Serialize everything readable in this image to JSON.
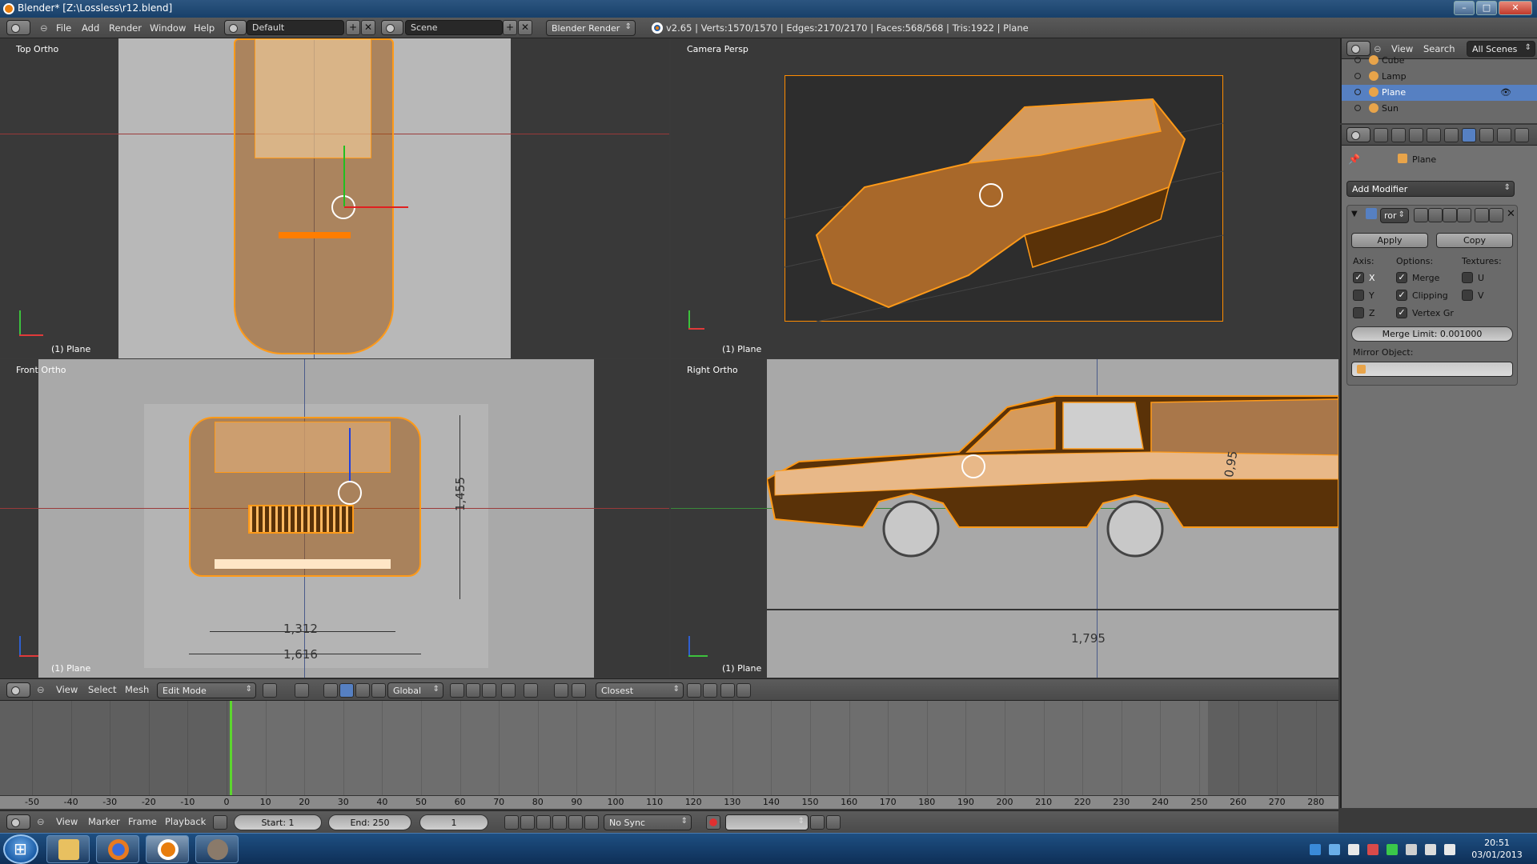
{
  "window": {
    "title": "Blender* [Z:\\Lossless\\r12.blend]"
  },
  "infobar": {
    "menus": [
      "File",
      "Add",
      "Render",
      "Window",
      "Help"
    ],
    "layout": "Default",
    "scene": "Scene",
    "engine": "Blender Render",
    "stats": "v2.65 | Verts:1570/1570 | Edges:2170/2170 | Faces:568/568 | Tris:1922 | Plane"
  },
  "viewports": {
    "top": {
      "label": "Top Ortho",
      "object": "(1) Plane"
    },
    "camera": {
      "label": "Camera Persp",
      "object": "(1) Plane"
    },
    "front": {
      "label": "Front Ortho",
      "object": "(1) Plane"
    },
    "right": {
      "label": "Right Ortho",
      "object": "(1) Plane"
    }
  },
  "blueprint": {
    "front_height": "1,455",
    "front_track": "1,312",
    "front_width": "1,616",
    "side_length": "1,795",
    "side_mark": "0,95"
  },
  "view3d_header": {
    "menus": [
      "View",
      "Select",
      "Mesh"
    ],
    "mode": "Edit Mode",
    "orientation": "Global",
    "snap": "Closest"
  },
  "timeline": {
    "ticks": [
      "-50",
      "-40",
      "-30",
      "-20",
      "-10",
      "0",
      "10",
      "20",
      "30",
      "40",
      "50",
      "60",
      "70",
      "80",
      "90",
      "100",
      "110",
      "120",
      "130",
      "140",
      "150",
      "160",
      "170",
      "180",
      "190",
      "200",
      "210",
      "220",
      "230",
      "240",
      "250",
      "260",
      "270",
      "280"
    ],
    "current_frame": 1,
    "menus": [
      "View",
      "Marker",
      "Frame",
      "Playback"
    ],
    "start": "Start: 1",
    "end": "End: 250",
    "frame": "1",
    "sync": "No Sync"
  },
  "outliner": {
    "menus": [
      "View",
      "Search"
    ],
    "filter": "All Scenes",
    "items": [
      {
        "name": "Cube",
        "color": "#e8a44a"
      },
      {
        "name": "Lamp",
        "color": "#e8a44a"
      },
      {
        "name": "Plane",
        "color": "#e8a44a"
      },
      {
        "name": "Sun",
        "color": "#e8a44a"
      }
    ]
  },
  "properties": {
    "context_object": "Plane",
    "add_modifier": "Add Modifier",
    "modifier_name": "ror",
    "apply": "Apply",
    "copy": "Copy",
    "axis_label": "Axis:",
    "options_label": "Options:",
    "textures_label": "Textures:",
    "axis": [
      {
        "label": "X",
        "checked": true
      },
      {
        "label": "Y",
        "checked": false
      },
      {
        "label": "Z",
        "checked": false
      }
    ],
    "options": [
      {
        "label": "Merge",
        "checked": true
      },
      {
        "label": "Clipping",
        "checked": true
      },
      {
        "label": "Vertex Gr",
        "checked": true
      }
    ],
    "textures": [
      {
        "label": "U",
        "checked": false
      },
      {
        "label": "V",
        "checked": false
      }
    ],
    "merge_limit": "Merge Limit: 0.001000",
    "mirror_object_label": "Mirror Object:"
  },
  "taskbar": {
    "time": "20:51",
    "date": "03/01/2013"
  },
  "colors": {
    "mesh": "#ff9a18",
    "timeline_cursor": "#5cd62e",
    "active_blue": "#5680c2"
  }
}
